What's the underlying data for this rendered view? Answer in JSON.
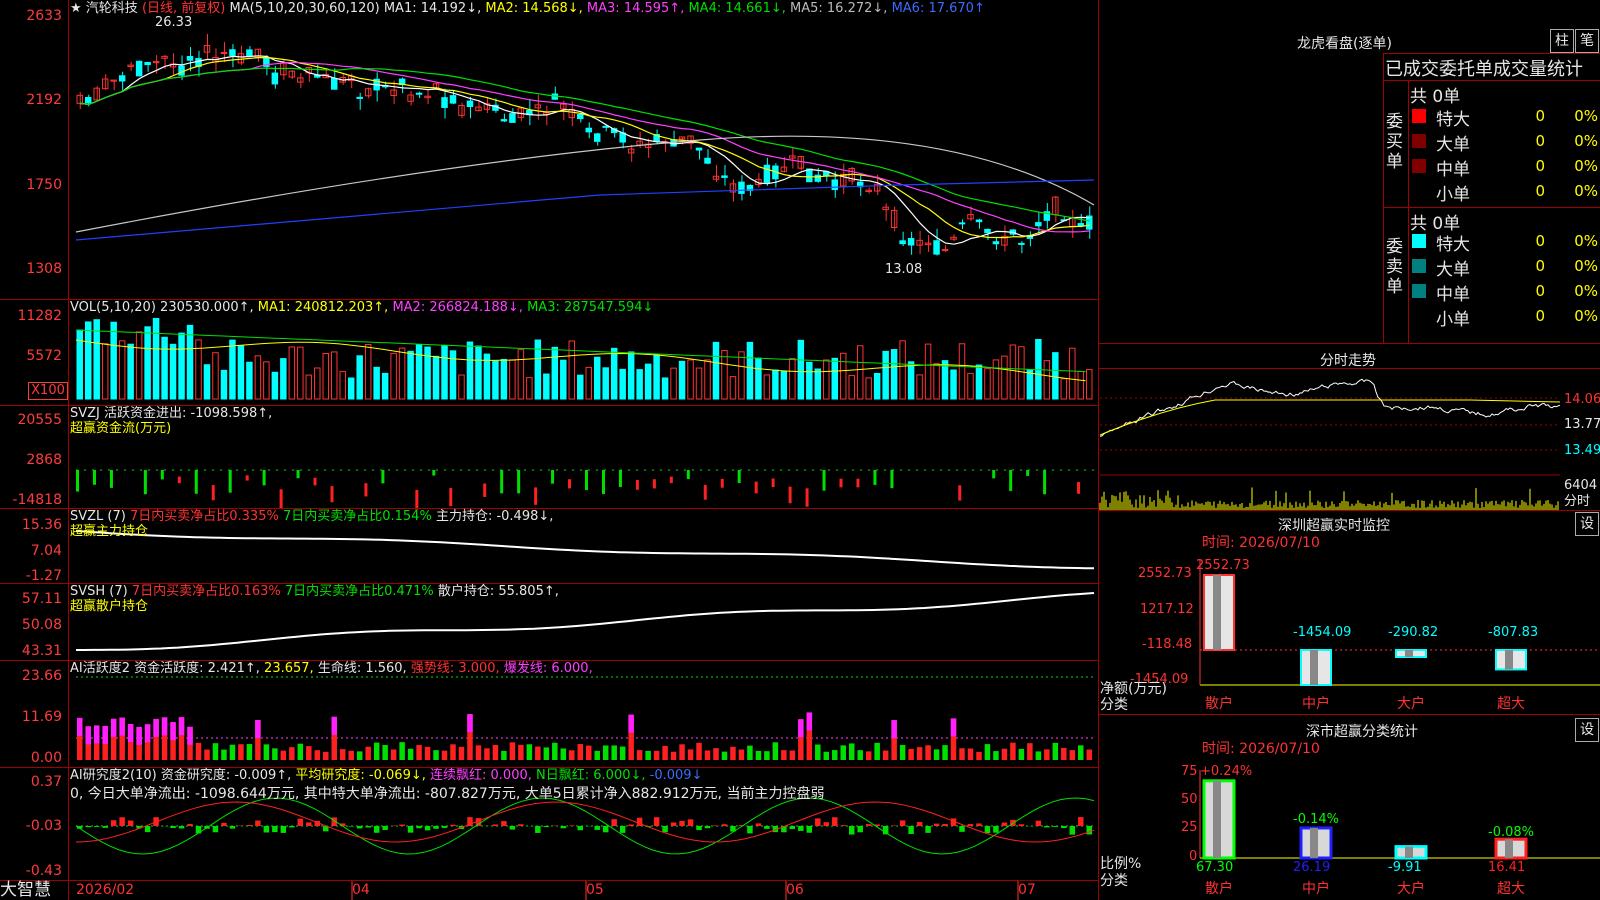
{
  "stock": {
    "star": "★",
    "name": "汽轮科技",
    "period": "(日线, 前复权)",
    "ma_label": "MA(5,10,20,30,60,120)",
    "ma1": "MA1: 14.192↓,",
    "ma2": "MA2: 14.568↓,",
    "ma3": "MA3: 14.595↑,",
    "ma4": "MA4: 14.661↓,",
    "ma5": "MA5: 16.272↓,",
    "ma6": "MA6: 17.670↑",
    "high_mark": "26.33",
    "low_mark": "13.08"
  },
  "main_axis": [
    "2633",
    "2192",
    "1750",
    "1308"
  ],
  "vol": {
    "label": "VOL(5,10,20)",
    "value": "230530.000↑,",
    "ma1": "MA1: 240812.203↑,",
    "ma2": "MA2: 266824.188↓,",
    "ma3": "MA3: 287547.594↓",
    "axis": [
      "11282",
      "5572"
    ],
    "unit": "X100"
  },
  "svzj": {
    "label": "SVZJ  活跃资金进出: -1098.598↑,",
    "sub": "超赢资金流(万元)",
    "axis": [
      "20555",
      "2868",
      "-14818"
    ]
  },
  "svzl": {
    "label": "SVZL (7)",
    "a": "7日内买卖净占比0.335%",
    "b": "7日内买卖净占比0.154%",
    "c": "主力持仓: -0.498↓,",
    "sub": "超赢主力持仓",
    "axis": [
      "15.36",
      "7.04",
      "-1.27"
    ]
  },
  "svsh": {
    "label": "SVSH (7)",
    "a": "7日内买卖净占比0.163%",
    "b": "7日内买卖净占比0.471%",
    "c": "散户持仓: 55.805↑,",
    "sub": "超赢散户持仓",
    "axis": [
      "57.11",
      "50.08",
      "43.31"
    ]
  },
  "ai_active": {
    "label": "AI活跃度2",
    "a": "资金活跃度: 2.421↑,",
    "b": "23.657,",
    "c": "生命线: 1.560,",
    "d": "强势线: 3.000,",
    "e": "爆发线: 6.000,",
    "axis": [
      "23.66",
      "11.69",
      "0.00"
    ]
  },
  "ai_research": {
    "label": "AI研究度2(10)",
    "a": "资金研究度: -0.009↑,",
    "b": "平均研究度: -0.069↓,",
    "c": "连续飘红: 0.000,",
    "d": "N日飘红: 6.000↓,",
    "e": "-0.009↓",
    "text": "0, 今日大单净流出: -1098.644万元, 其中特大单净流出: -807.827万元, 大单5日累计净入882.912万元, 当前主力控盘弱",
    "axis": [
      "0.37",
      "-0.03",
      "-0.43"
    ]
  },
  "dates": [
    "2026/02",
    "04",
    "05",
    "06",
    "07"
  ],
  "brand": "大智慧",
  "dragon": {
    "title": "龙虎看盘(逐单)",
    "btn1": "柱",
    "btn2": "笔",
    "header": "已成交委托单成交量统计",
    "buy_side": "委买单",
    "sell_side": "委卖单",
    "buy_total": "共 0单",
    "sell_total": "共 0单",
    "buy_rows": [
      {
        "label": "特大",
        "num": "0",
        "pct": "0%",
        "color": "#ff0000"
      },
      {
        "label": "大单",
        "num": "0",
        "pct": "0%",
        "color": "#800000"
      },
      {
        "label": "中单",
        "num": "0",
        "pct": "0%",
        "color": "#800000"
      },
      {
        "label": "小单",
        "num": "0",
        "pct": "0%",
        "color": ""
      }
    ],
    "sell_rows": [
      {
        "label": "特大",
        "num": "0",
        "pct": "0%",
        "color": "#00ffff"
      },
      {
        "label": "大单",
        "num": "0",
        "pct": "0%",
        "color": "#008080"
      },
      {
        "label": "中单",
        "num": "0",
        "pct": "0%",
        "color": "#008080"
      },
      {
        "label": "小单",
        "num": "0",
        "pct": "0%",
        "color": ""
      }
    ]
  },
  "intraday": {
    "title": "分时走势",
    "axis": [
      "14.06",
      "13.77",
      "13.49"
    ],
    "vol_value": "6404",
    "vol_unit": "分时"
  },
  "monitor": {
    "title": "深圳超赢实时监控",
    "btn": "设",
    "time": "时间: 2026/07/10",
    "axis": [
      "2552.73",
      "1217.12",
      "-118.48",
      "-1454.09"
    ],
    "y_label": "净额(万元)",
    "x_label": "分类",
    "bars": [
      {
        "cat": "散户",
        "value": 2552.73,
        "label": "2552.73"
      },
      {
        "cat": "中户",
        "value": -1454.09,
        "label": "-1454.09"
      },
      {
        "cat": "大户",
        "value": -290.82,
        "label": "-290.82"
      },
      {
        "cat": "超大",
        "value": -807.83,
        "label": "-807.83"
      }
    ]
  },
  "classify": {
    "title": "深市超赢分类统计",
    "btn": "设",
    "time": "时间: 2026/07/10",
    "axis": [
      "75",
      "50",
      "25",
      "0"
    ],
    "y_label": "比例%",
    "x_label": "分类",
    "top_label": "+0.24%",
    "bars": [
      {
        "cat": "散户",
        "value": 67.3,
        "label": "67.30",
        "chg": "",
        "color": "#00ff00"
      },
      {
        "cat": "中户",
        "value": 26.19,
        "label": "26.19",
        "chg": "-0.14%",
        "color": "#2020ff"
      },
      {
        "cat": "大户",
        "value": -9.91,
        "label": "-9.91",
        "chg": "",
        "color": "#00ffff"
      },
      {
        "cat": "超大",
        "value": 16.41,
        "label": "16.41",
        "chg": "-0.08%",
        "color": "#ff2020"
      }
    ]
  }
}
